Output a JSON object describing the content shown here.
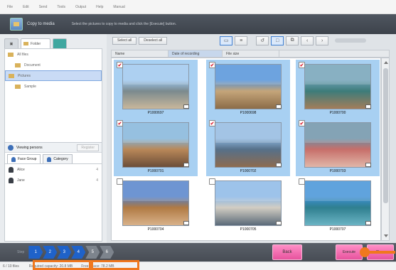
{
  "menu": [
    "File",
    "Edit",
    "Send",
    "Tools",
    "Output",
    "Help",
    "Manual"
  ],
  "header": {
    "title": "Copy to media",
    "instruction": "Select the pictures to copy to media and click the [Execute] button."
  },
  "left_panel": {
    "folder_tab": "Folder",
    "tree": [
      {
        "label": "All files",
        "level": 0,
        "selected": false
      },
      {
        "label": "Document",
        "level": 1,
        "selected": false
      },
      {
        "label": "Pictures",
        "level": 0,
        "selected": true
      },
      {
        "label": "Sample",
        "level": 1,
        "selected": false
      }
    ],
    "favorites": {
      "title": "Viewing persons",
      "button": "Register",
      "tabs": [
        "Face Group",
        "Category"
      ],
      "people": [
        {
          "name": "Alice",
          "count": "4"
        },
        {
          "name": "Jane",
          "count": "4"
        }
      ]
    }
  },
  "toolbar": {
    "select_all": "Select all",
    "deselect_all": "Deselect all"
  },
  "columns": [
    "Name",
    "Date of recording",
    "File size"
  ],
  "photos": [
    {
      "name": "P1000697",
      "selected": true,
      "checked": true,
      "colors": [
        "#9cc6ee",
        "#7b8a8e",
        "#c9b79b"
      ]
    },
    {
      "name": "P1000698",
      "selected": true,
      "checked": true,
      "colors": [
        "#4e8fd8",
        "#c4a57a",
        "#8c6c48"
      ]
    },
    {
      "name": "P1000700",
      "selected": true,
      "checked": true,
      "colors": [
        "#6e9fb5",
        "#3d7c7a",
        "#a37d5a"
      ]
    },
    {
      "name": "P1000701",
      "selected": true,
      "checked": true,
      "colors": [
        "#7fb3da",
        "#b98859",
        "#6b4d38"
      ]
    },
    {
      "name": "P1000702",
      "selected": true,
      "checked": true,
      "colors": [
        "#8fb8e0",
        "#567089",
        "#8d6b4f"
      ]
    },
    {
      "name": "P1000703",
      "selected": true,
      "checked": true,
      "colors": [
        "#6a8fa5",
        "#c76f6a",
        "#e0b6a8"
      ]
    },
    {
      "name": "P1000704",
      "selected": false,
      "checked": false,
      "colors": [
        "#4f7ec8",
        "#b07a44",
        "#d8b28a"
      ]
    },
    {
      "name": "P1000705",
      "selected": false,
      "checked": false,
      "colors": [
        "#88b6e6",
        "#d2cdc3",
        "#5b6a78"
      ]
    },
    {
      "name": "P1000707",
      "selected": false,
      "checked": false,
      "colors": [
        "#3e8fd6",
        "#2f7f8f",
        "#6bb4c4"
      ]
    }
  ],
  "checkmark": "✔",
  "footer": {
    "step_label": "Step",
    "steps": [
      "1",
      "2",
      "3",
      "4",
      "5",
      "6"
    ],
    "back": "Back",
    "execute": "Execute",
    "close": "Close"
  },
  "status": {
    "pictures": "6 / 10 files",
    "required": "Required capacity: 20.8 MB",
    "free": "Free space: 78.2 MB"
  },
  "colors": {
    "accent": "#1f62c9",
    "selection": "#a8d0f2",
    "button": "#e7539e",
    "highlight": "#f0781e"
  }
}
